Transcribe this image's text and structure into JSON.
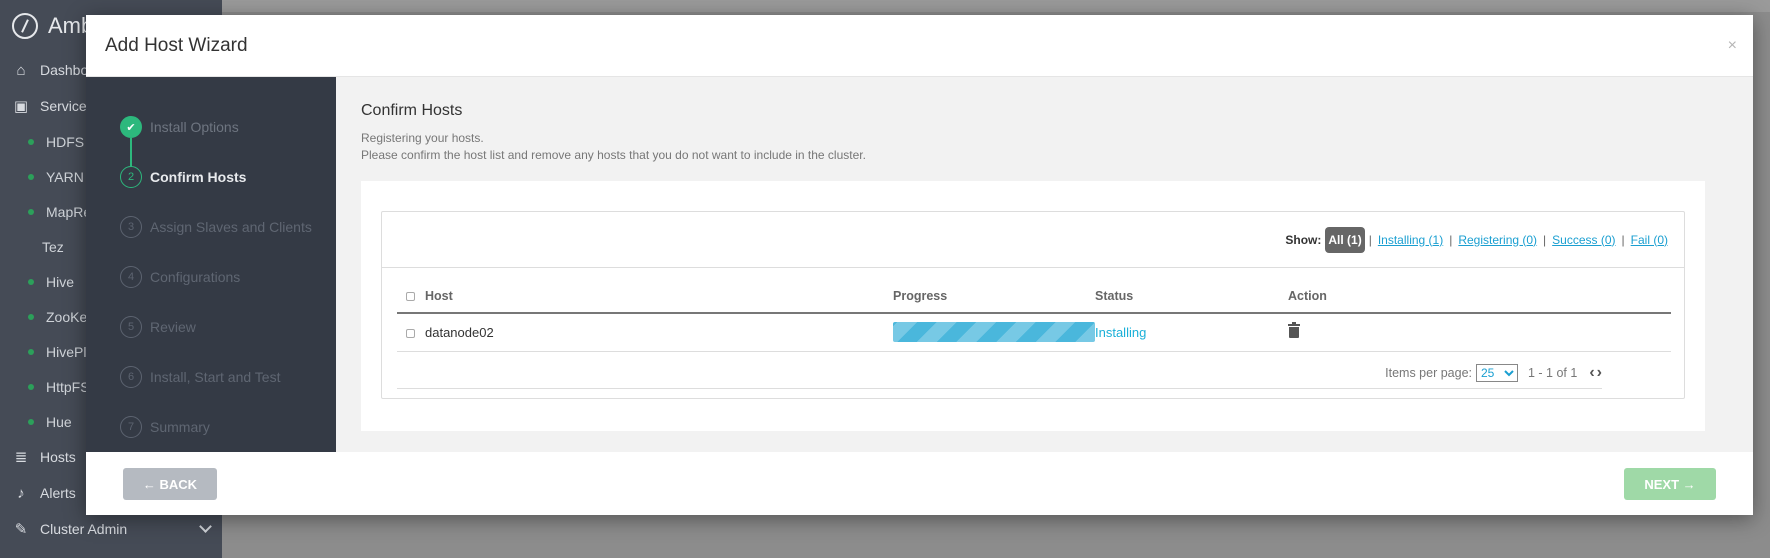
{
  "app": {
    "brand": "Amb",
    "nav": {
      "dashboard": "Dashbo",
      "services": "Service",
      "hosts": "Hosts",
      "alerts": "Alerts",
      "cluster_admin": "Cluster Admin"
    },
    "services": [
      {
        "label": "HDFS",
        "dot": true
      },
      {
        "label": "YARN",
        "dot": true
      },
      {
        "label": "MapRe",
        "dot": true
      },
      {
        "label": "Tez",
        "dot": false
      },
      {
        "label": "Hive",
        "dot": true
      },
      {
        "label": "ZooKee",
        "dot": true
      },
      {
        "label": "HivePlu",
        "dot": true
      },
      {
        "label": "HttpFS",
        "dot": true
      },
      {
        "label": "Hue",
        "dot": true
      }
    ]
  },
  "modal": {
    "title": "Add Host Wizard",
    "close": "×"
  },
  "wizard": {
    "steps": [
      {
        "num": "✔",
        "label": "Install Options",
        "state": "done"
      },
      {
        "num": "2",
        "label": "Confirm Hosts",
        "state": "active"
      },
      {
        "num": "3",
        "label": "Assign Slaves and Clients",
        "state": "todo"
      },
      {
        "num": "4",
        "label": "Configurations",
        "state": "todo"
      },
      {
        "num": "5",
        "label": "Review",
        "state": "todo"
      },
      {
        "num": "6",
        "label": "Install, Start and Test",
        "state": "todo"
      },
      {
        "num": "7",
        "label": "Summary",
        "state": "todo"
      }
    ]
  },
  "content": {
    "title": "Confirm Hosts",
    "desc_line1": "Registering your hosts.",
    "desc_line2": "Please confirm the host list and remove any hosts that you do not want to include in the cluster."
  },
  "filter": {
    "show_label": "Show:",
    "all": "All (1)",
    "installing": "Installing (1)",
    "registering": "Registering (0)",
    "success": "Success (0)",
    "fail": "Fail (0)",
    "sep": "|"
  },
  "table": {
    "columns": {
      "host": "Host",
      "progress": "Progress",
      "status": "Status",
      "action": "Action"
    },
    "rows": [
      {
        "host": "datanode02",
        "progress_pct": 100,
        "status": "Installing",
        "action_icon": "trash-icon"
      }
    ]
  },
  "pager": {
    "items_label": "Items per page:",
    "per_page": "25",
    "range": "1 - 1 of 1",
    "prev": "‹",
    "next": "›"
  },
  "footer": {
    "back": "← BACK",
    "next": "NEXT →"
  },
  "colors": {
    "accent_green": "#2db87d",
    "link_blue": "#1a9fd1",
    "progress_blue": "#4ab7dc",
    "sidebar_dark": "#343a45"
  }
}
